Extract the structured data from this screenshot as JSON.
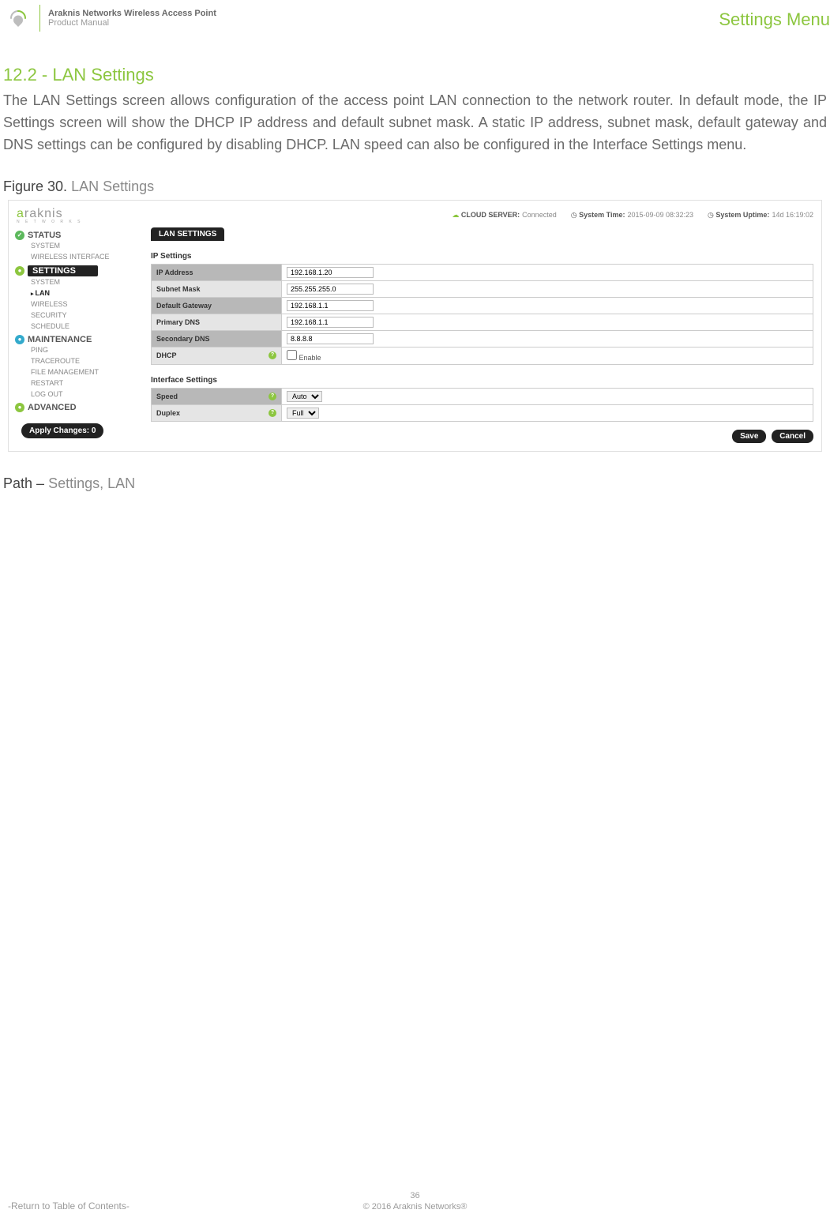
{
  "header": {
    "product_line1": "Araknis Networks Wireless Access Point",
    "product_line2": "Product Manual",
    "right_link": "Settings Menu"
  },
  "section": {
    "title": "12.2 - LAN Settings",
    "body": "The LAN Settings screen allows configuration of the access point LAN connection to the network router. In default mode, the IP Settings screen will show the DHCP IP address and default subnet mask. A static IP address, subnet mask, default gateway and DNS settings can be configured by disabling DHCP. LAN speed can also be configured in the Interface Settings menu."
  },
  "figure": {
    "label": "Figure 30.",
    "desc": "LAN Settings"
  },
  "screenshot": {
    "logo_brand": "araknis",
    "logo_sub": "N E T W O R K S",
    "topbar": {
      "cloud_label": "CLOUD SERVER:",
      "cloud_value": "Connected",
      "time_label": "System Time:",
      "time_value": "2015-09-09 08:32:23",
      "uptime_label": "System Uptime:",
      "uptime_value": "14d 16:19:02"
    },
    "nav": {
      "status": {
        "label": "STATUS",
        "items": [
          "SYSTEM",
          "WIRELESS INTERFACE"
        ]
      },
      "settings": {
        "label": "SETTINGS",
        "items": [
          "SYSTEM",
          "LAN",
          "WIRELESS",
          "SECURITY",
          "SCHEDULE"
        ]
      },
      "maintenance": {
        "label": "MAINTENANCE",
        "items": [
          "PING",
          "TRACEROUTE",
          "FILE MANAGEMENT",
          "RESTART",
          "LOG OUT"
        ]
      },
      "advanced": {
        "label": "ADVANCED"
      },
      "apply_changes": "Apply Changes: 0"
    },
    "main": {
      "page_tab": "LAN SETTINGS",
      "ip_section": "IP Settings",
      "rows": {
        "ip_address_label": "IP Address",
        "ip_address_value": "192.168.1.20",
        "subnet_label": "Subnet Mask",
        "subnet_value": "255.255.255.0",
        "gateway_label": "Default Gateway",
        "gateway_value": "192.168.1.1",
        "pdns_label": "Primary DNS",
        "pdns_value": "192.168.1.1",
        "sdns_label": "Secondary DNS",
        "sdns_value": "8.8.8.8",
        "dhcp_label": "DHCP",
        "dhcp_enable": "Enable"
      },
      "iface_section": "Interface Settings",
      "iface": {
        "speed_label": "Speed",
        "speed_value": "Auto",
        "duplex_label": "Duplex",
        "duplex_value": "Full"
      },
      "save": "Save",
      "cancel": "Cancel"
    }
  },
  "path": {
    "label": "Path –",
    "value": "Settings, LAN"
  },
  "footer": {
    "page_num": "36",
    "copyright": "© 2016 Araknis Networks®",
    "toc": "-Return to Table of Contents-"
  }
}
